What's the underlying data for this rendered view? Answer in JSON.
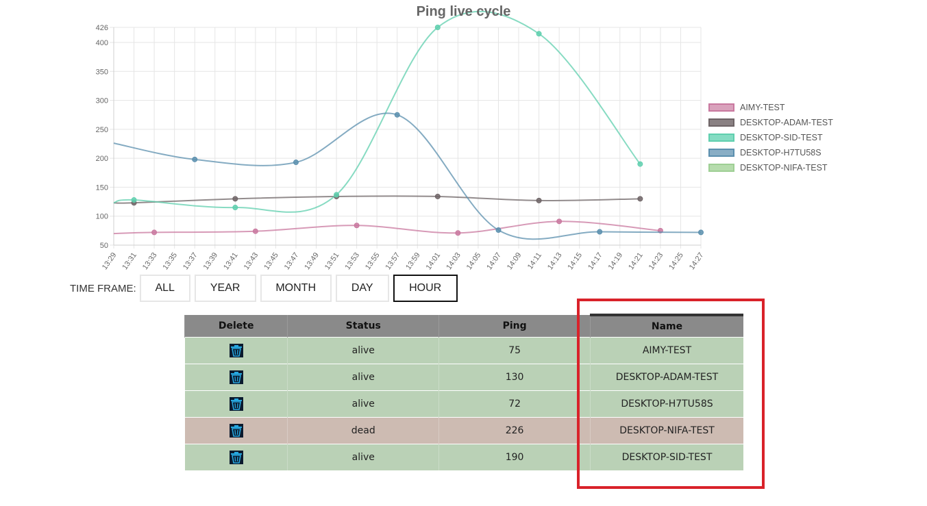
{
  "chart_data": {
    "type": "line",
    "title": "Ping live cycle",
    "xlabel": "",
    "ylabel": "",
    "x": [
      "13:29",
      "13:31",
      "13:33",
      "13:35",
      "13:37",
      "13:39",
      "13:41",
      "13:43",
      "13:45",
      "13:47",
      "13:49",
      "13:51",
      "13:53",
      "13:55",
      "13:57",
      "13:59",
      "14:01",
      "14:03",
      "14:05",
      "14:07",
      "14:09",
      "14:11",
      "14:13",
      "14:15",
      "14:17",
      "14:19",
      "14:21",
      "14:23",
      "14:25",
      "14:27"
    ],
    "ylim": [
      50,
      426
    ],
    "yticks": [
      "50",
      "100",
      "150",
      "200",
      "250",
      "300",
      "350",
      "400",
      "426"
    ],
    "grid": true,
    "legend_position": "right",
    "series": [
      {
        "name": "AIMY-TEST",
        "color": "#c9789f",
        "fill": "#d9a2bc",
        "points": [
          [
            "13:29",
            70
          ],
          [
            "13:33",
            72
          ],
          [
            "13:43",
            74
          ],
          [
            "13:53",
            84
          ],
          [
            "14:03",
            71
          ],
          [
            "14:13",
            91
          ],
          [
            "14:23",
            75
          ]
        ]
      },
      {
        "name": "DESKTOP-ADAM-TEST",
        "color": "#6e6466",
        "fill": "#8a8183",
        "points": [
          [
            "13:29",
            123
          ],
          [
            "13:31",
            123
          ],
          [
            "13:41",
            130
          ],
          [
            "13:51",
            134
          ],
          [
            "14:01",
            134
          ],
          [
            "14:11",
            127
          ],
          [
            "14:21",
            130
          ]
        ]
      },
      {
        "name": "DESKTOP-SID-TEST",
        "color": "#5fcfae",
        "fill": "#85dcc3",
        "points": [
          [
            "13:29",
            123
          ],
          [
            "13:31",
            128
          ],
          [
            "13:41",
            115
          ],
          [
            "13:51",
            137
          ],
          [
            "14:01",
            426
          ],
          [
            "14:11",
            415
          ],
          [
            "14:21",
            190
          ]
        ]
      },
      {
        "name": "DESKTOP-H7TU58S",
        "color": "#5b8fae",
        "fill": "#89aec5",
        "points": [
          [
            "13:29",
            226
          ],
          [
            "13:37",
            198
          ],
          [
            "13:47",
            193
          ],
          [
            "13:57",
            275
          ],
          [
            "14:07",
            76
          ],
          [
            "14:17",
            73
          ],
          [
            "14:27",
            72
          ]
        ]
      },
      {
        "name": "DESKTOP-NIFA-TEST",
        "color": "#9ecf94",
        "fill": "#b6dcad",
        "points": []
      }
    ]
  },
  "timeframe": {
    "label": "TIME FRAME:",
    "buttons": [
      "ALL",
      "YEAR",
      "MONTH",
      "DAY",
      "HOUR"
    ],
    "active": "HOUR"
  },
  "table": {
    "headers": {
      "delete": "Delete",
      "status": "Status",
      "ping": "Ping",
      "name": "Name"
    },
    "rows": [
      {
        "status": "alive",
        "ping": "75",
        "name": "AIMY-TEST"
      },
      {
        "status": "alive",
        "ping": "130",
        "name": "DESKTOP-ADAM-TEST"
      },
      {
        "status": "alive",
        "ping": "72",
        "name": "DESKTOP-H7TU58S"
      },
      {
        "status": "dead",
        "ping": "226",
        "name": "DESKTOP-NIFA-TEST"
      },
      {
        "status": "alive",
        "ping": "190",
        "name": "DESKTOP-SID-TEST"
      }
    ],
    "delete_icon": "trash-icon",
    "colors": {
      "alive": "#bad1b6",
      "dead": "#cdbbb2",
      "header": "#8a8a8a"
    }
  },
  "highlight_color": "#d9222a"
}
